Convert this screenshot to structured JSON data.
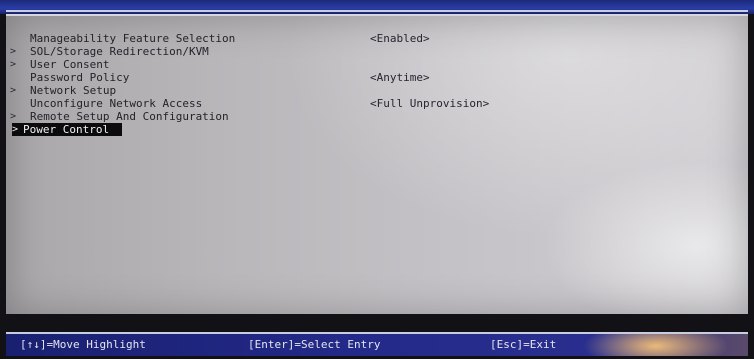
{
  "menu": {
    "items": [
      {
        "label": "Manageability Feature Selection",
        "value": "<Enabled>",
        "submenu": false
      },
      {
        "label": "SOL/Storage Redirection/KVM",
        "value": "",
        "submenu": true
      },
      {
        "label": "User Consent",
        "value": "",
        "submenu": true
      },
      {
        "label": "Password Policy",
        "value": "<Anytime>",
        "submenu": false
      },
      {
        "label": "Network Setup",
        "value": "",
        "submenu": true
      },
      {
        "label": "Unconfigure Network Access",
        "value": "<Full Unprovision>",
        "submenu": false
      },
      {
        "label": "Remote Setup And Configuration",
        "value": "",
        "submenu": true
      },
      {
        "label": "Power Control",
        "value": "",
        "submenu": true,
        "selected": true
      }
    ],
    "submenu_glyph": ">"
  },
  "help_bar": {
    "move": "[↑↓]=Move Highlight",
    "select": "[Enter]=Select Entry",
    "exit": "[Esc]=Exit"
  },
  "colors": {
    "panel": "#bdbbbf",
    "highlight": "#0b0b0e",
    "bar": "#232a8a"
  }
}
